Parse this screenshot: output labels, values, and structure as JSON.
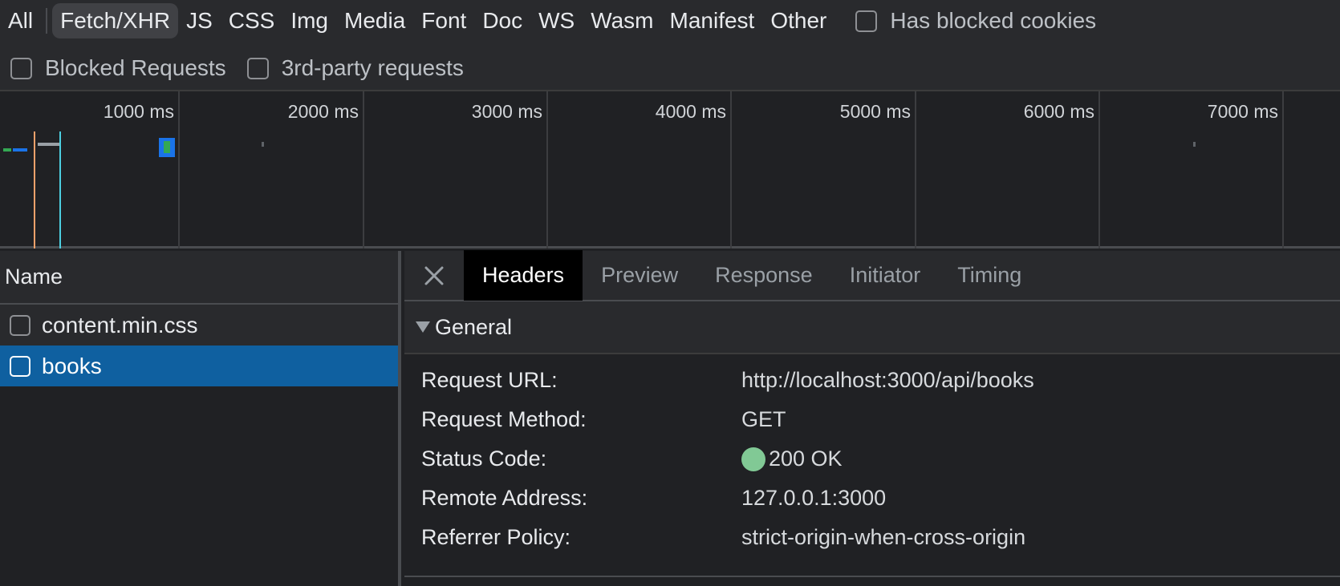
{
  "filters": {
    "types": [
      {
        "label": "All",
        "active": false
      },
      {
        "label": "Fetch/XHR",
        "active": true
      },
      {
        "label": "JS",
        "active": false
      },
      {
        "label": "CSS",
        "active": false
      },
      {
        "label": "Img",
        "active": false
      },
      {
        "label": "Media",
        "active": false
      },
      {
        "label": "Font",
        "active": false
      },
      {
        "label": "Doc",
        "active": false
      },
      {
        "label": "WS",
        "active": false
      },
      {
        "label": "Wasm",
        "active": false
      },
      {
        "label": "Manifest",
        "active": false
      },
      {
        "label": "Other",
        "active": false
      }
    ],
    "has_blocked_cookies": "Has blocked cookies",
    "blocked_requests": "Blocked Requests",
    "third_party": "3rd-party requests"
  },
  "timeline": {
    "labels": [
      "1000 ms",
      "2000 ms",
      "3000 ms",
      "4000 ms",
      "5000 ms",
      "6000 ms",
      "7000 ms"
    ],
    "colors": {
      "dom_content_loaded": "#4dd0e1",
      "load": "#f4a16b",
      "waiting": "#1a73e8",
      "download": "#34a853"
    }
  },
  "requests": {
    "header": "Name",
    "rows": [
      {
        "name": "content.min.css",
        "selected": false
      },
      {
        "name": "books",
        "selected": true
      }
    ]
  },
  "details": {
    "tabs": [
      {
        "label": "Headers",
        "active": true
      },
      {
        "label": "Preview",
        "active": false
      },
      {
        "label": "Response",
        "active": false
      },
      {
        "label": "Initiator",
        "active": false
      },
      {
        "label": "Timing",
        "active": false
      }
    ],
    "general": {
      "title": "General",
      "request_url_key": "Request URL:",
      "request_url": "http://localhost:3000/api/books",
      "request_method_key": "Request Method:",
      "request_method": "GET",
      "status_code_key": "Status Code:",
      "status_code": "200 OK",
      "status_color": "#81c995",
      "remote_address_key": "Remote Address:",
      "remote_address": "127.0.0.1:3000",
      "referrer_policy_key": "Referrer Policy:",
      "referrer_policy": "strict-origin-when-cross-origin"
    }
  }
}
